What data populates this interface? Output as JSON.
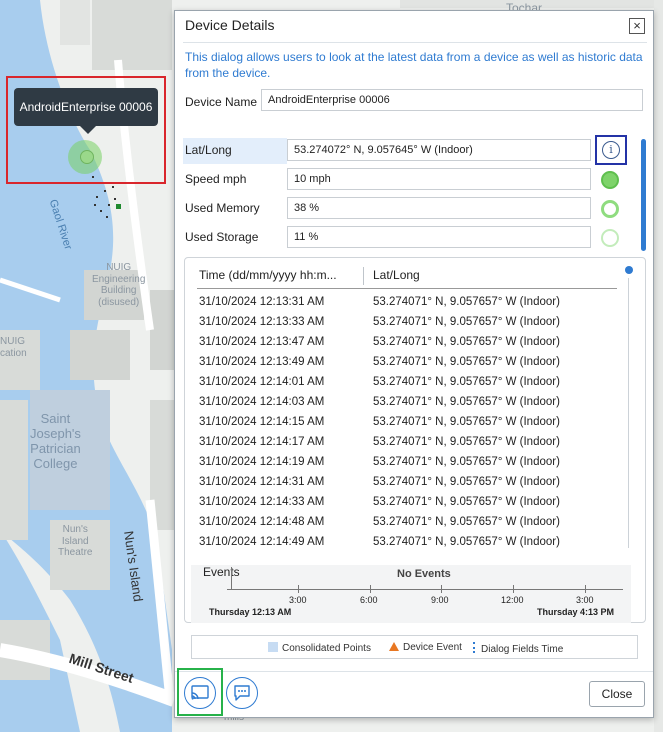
{
  "map": {
    "labels": {
      "gaol_river": "Gaol River",
      "nuig_engineering": [
        "NUIG",
        "Engineering",
        "Building",
        "(disused)"
      ],
      "nuig_left": [
        "NUIG",
        "cation"
      ],
      "st_josephs": [
        "Saint",
        "Joseph's",
        "Patrician",
        "College"
      ],
      "nuns_island_theatre": [
        "Nun's",
        "Island",
        "Theatre"
      ],
      "nuns_island_street": "Nun's Island",
      "mill_street": "Mill Street",
      "top_right_fragment": "Tochar",
      "bottom_fragment": "mills"
    },
    "device_tooltip": "AndroidEnterprise 00006"
  },
  "dialog": {
    "title": "Device Details",
    "close_glyph": "×",
    "description": "This dialog allows users to look at the latest data from a device as well as historic data from the device.",
    "device_name_label": "Device Name",
    "device_name_value": "AndroidEnterprise 00006",
    "fields": [
      {
        "label": "Lat/Long",
        "value": "53.274072° N, 9.057645° W (Indoor)",
        "indicator": "info-icon"
      },
      {
        "label": "Speed mph",
        "value": "10 mph",
        "indicator": "green-filled"
      },
      {
        "label": "Used Memory",
        "value": "38 %",
        "indicator": "green-ring"
      },
      {
        "label": "Used Storage",
        "value": "11 %",
        "indicator": "light-ring"
      }
    ],
    "info_glyph": "i",
    "history": {
      "col_time": "Time (dd/mm/yyyy hh:m...",
      "col_latlong": "Lat/Long",
      "rows": [
        {
          "time": "31/10/2024 12:13:31 AM",
          "latlong": "53.274071° N, 9.057657° W (Indoor)"
        },
        {
          "time": "31/10/2024 12:13:33 AM",
          "latlong": "53.274071° N, 9.057657° W (Indoor)"
        },
        {
          "time": "31/10/2024 12:13:47 AM",
          "latlong": "53.274071° N, 9.057657° W (Indoor)"
        },
        {
          "time": "31/10/2024 12:13:49 AM",
          "latlong": "53.274071° N, 9.057657° W (Indoor)"
        },
        {
          "time": "31/10/2024 12:14:01 AM",
          "latlong": "53.274071° N, 9.057657° W (Indoor)"
        },
        {
          "time": "31/10/2024 12:14:03 AM",
          "latlong": "53.274071° N, 9.057657° W (Indoor)"
        },
        {
          "time": "31/10/2024 12:14:15 AM",
          "latlong": "53.274071° N, 9.057657° W (Indoor)"
        },
        {
          "time": "31/10/2024 12:14:17 AM",
          "latlong": "53.274071° N, 9.057657° W (Indoor)"
        },
        {
          "time": "31/10/2024 12:14:19 AM",
          "latlong": "53.274071° N, 9.057657° W (Indoor)"
        },
        {
          "time": "31/10/2024 12:14:31 AM",
          "latlong": "53.274071° N, 9.057657° W (Indoor)"
        },
        {
          "time": "31/10/2024 12:14:33 AM",
          "latlong": "53.274071° N, 9.057657° W (Indoor)"
        },
        {
          "time": "31/10/2024 12:14:48 AM",
          "latlong": "53.274071° N, 9.057657° W (Indoor)"
        },
        {
          "time": "31/10/2024 12:14:49 AM",
          "latlong": "53.274071° N, 9.057657° W (Indoor)"
        }
      ]
    },
    "timeline": {
      "events_label": "Events",
      "no_events": "No Events",
      "ticks": [
        "3:00",
        "6:00",
        "9:00",
        "12:00",
        "3:00"
      ],
      "start": "Thursday 12:13 AM",
      "end": "Thursday 4:13 PM"
    },
    "legend": {
      "consolidated": "Consolidated Points",
      "device_event": "Device Event",
      "dialog_fields_time": "Dialog Fields Time"
    },
    "close_button": "Close"
  },
  "colors": {
    "accent": "#2f7bd1",
    "tooltip_bg": "#2f3a44",
    "device_marker_border": "#d9262c",
    "info_highlight_border": "#2433a6",
    "cast_highlight_border": "#27b24a",
    "status_green": "#7ed36a",
    "device_event": "#e87722"
  },
  "icons": {
    "cast": "cast-icon",
    "chat": "chat-icon"
  }
}
